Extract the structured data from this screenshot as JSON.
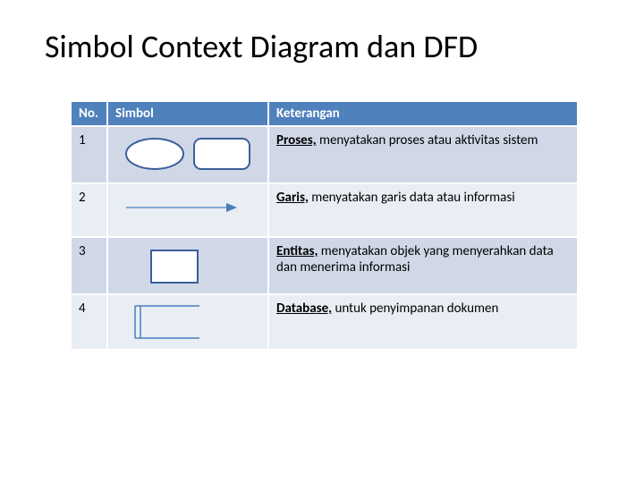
{
  "title": "Simbol Context Diagram dan DFD",
  "headers": {
    "no": "No.",
    "simbol": "Simbol",
    "ket": "Keterangan"
  },
  "rows": [
    {
      "no": "1",
      "symbol": "ellipse-roundrect",
      "bold": "Proses,",
      "rest": " menyatakan proses atau aktivitas sistem"
    },
    {
      "no": "2",
      "symbol": "arrow",
      "bold": "Garis,",
      "rest": " menyatakan garis data atau informasi"
    },
    {
      "no": "3",
      "symbol": "rect",
      "bold": "Entitas,",
      "rest": " menyatakan objek yang menyerahkan data dan menerima informasi"
    },
    {
      "no": "4",
      "symbol": "database",
      "bold": "Database,",
      "rest": " untuk penyimpanan dokumen"
    }
  ]
}
